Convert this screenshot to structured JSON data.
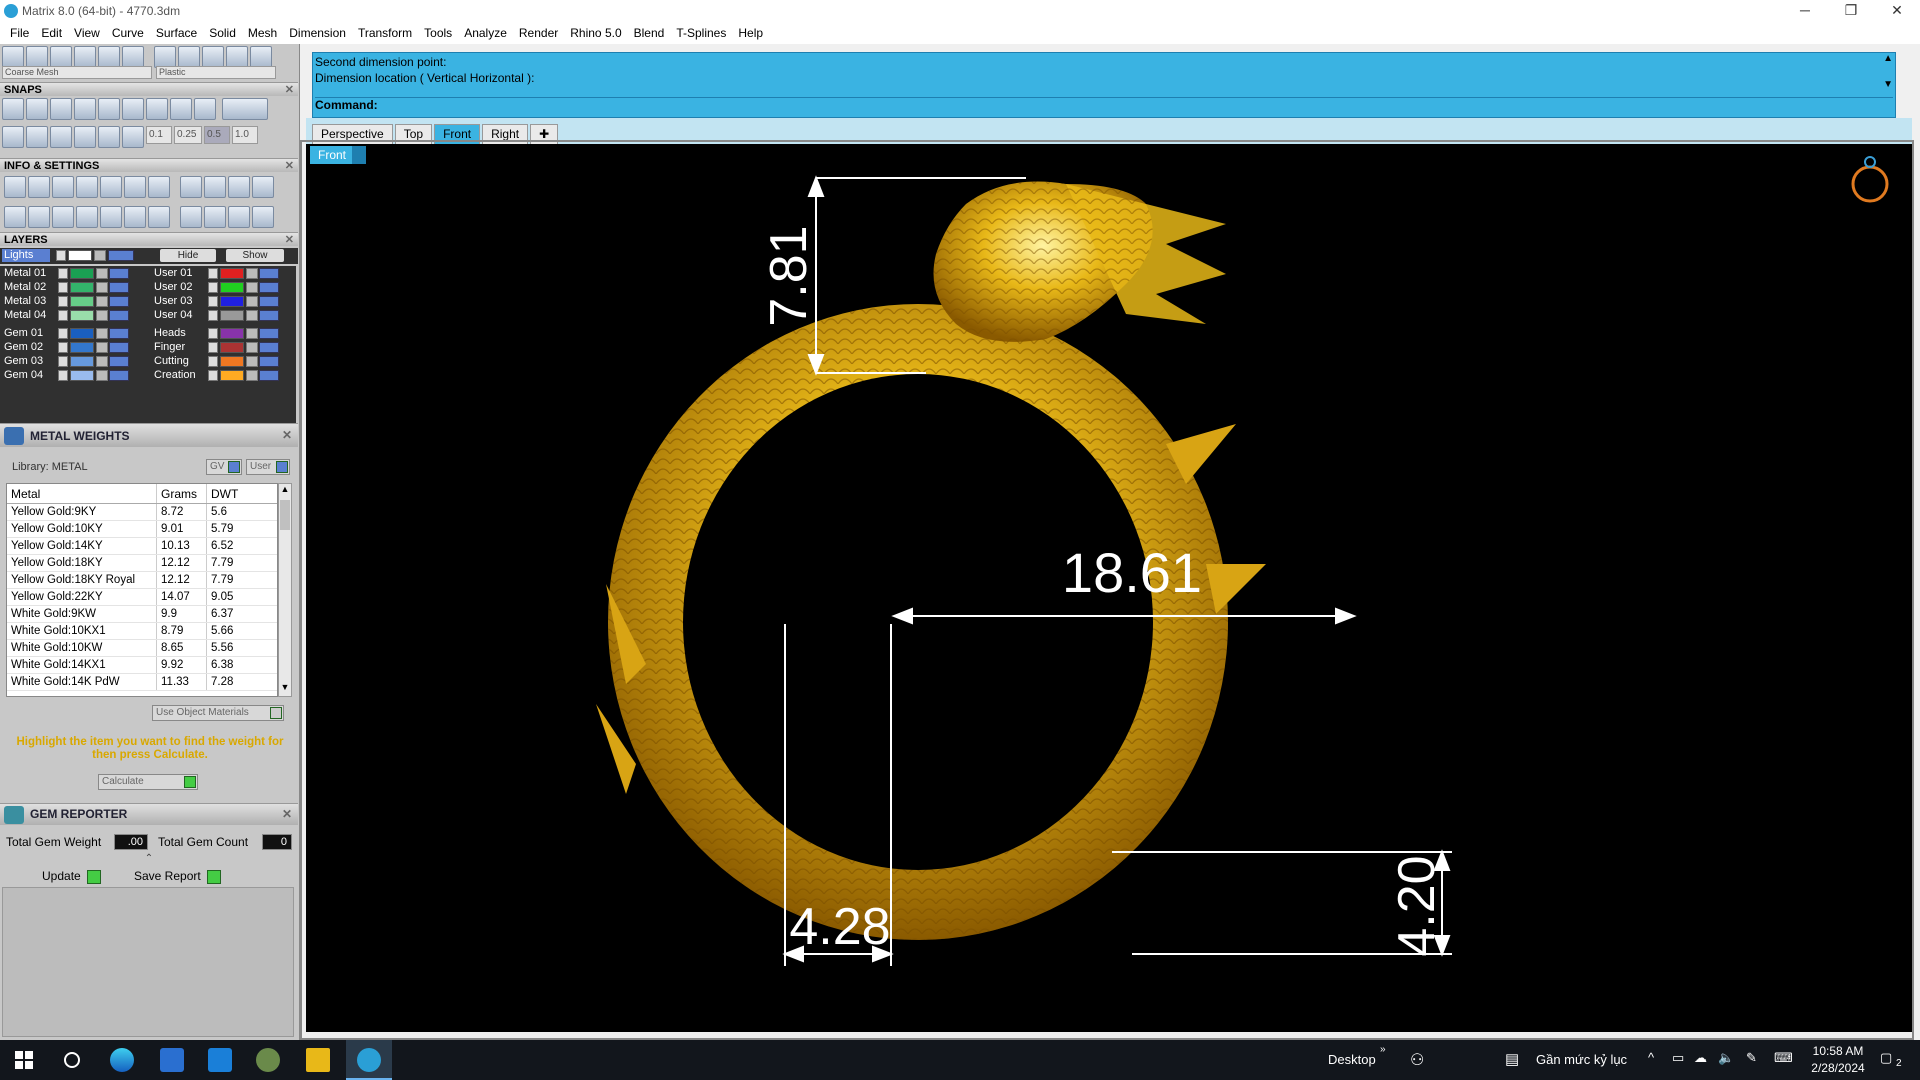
{
  "window": {
    "title": "Matrix 8.0 (64-bit) - 4770.3dm"
  },
  "menu": [
    "File",
    "Edit",
    "View",
    "Curve",
    "Surface",
    "Solid",
    "Mesh",
    "Dimension",
    "Transform",
    "Tools",
    "Analyze",
    "Render",
    "Rhino 5.0",
    "Blend",
    "T-Splines",
    "Help"
  ],
  "toolbar": {
    "mesh_dropdown": "Coarse Mesh",
    "material_dropdown": "Plastic"
  },
  "snaps": {
    "title": "SNAPS",
    "values": [
      "0.1",
      "0.25",
      "0.5",
      "1.0"
    ]
  },
  "info": {
    "title": "INFO & SETTINGS"
  },
  "layers": {
    "title": "LAYERS",
    "lights_label": "Lights",
    "hide_label": "Hide",
    "show_label": "Show",
    "left": [
      {
        "name": "Metal 01",
        "color": "#1aa053"
      },
      {
        "name": "Metal 02",
        "color": "#33b36b"
      },
      {
        "name": "Metal 03",
        "color": "#66cc88"
      },
      {
        "name": "Metal 04",
        "color": "#99ddaa"
      },
      {
        "name": "Gem 01",
        "color": "#1a5fbf"
      },
      {
        "name": "Gem 02",
        "color": "#3377cc"
      },
      {
        "name": "Gem 03",
        "color": "#6699dd"
      },
      {
        "name": "Gem 04",
        "color": "#99bbee"
      }
    ],
    "right": [
      {
        "name": "User 01",
        "color": "#e02020"
      },
      {
        "name": "User 02",
        "color": "#20d020"
      },
      {
        "name": "User 03",
        "color": "#2020e0"
      },
      {
        "name": "User 04",
        "color": "#999999"
      },
      {
        "name": "Heads",
        "color": "#8833aa"
      },
      {
        "name": "Finger",
        "color": "#aa3333"
      },
      {
        "name": "Cutting",
        "color": "#ee7722"
      },
      {
        "name": "Creation",
        "color": "#ffaa22"
      }
    ]
  },
  "metal_weights": {
    "title": "METAL WEIGHTS",
    "library": "Library: METAL",
    "gv": "GV",
    "user": "User",
    "columns": [
      "Metal",
      "Grams",
      "DWT"
    ],
    "rows": [
      [
        "Yellow Gold:9KY",
        "8.72",
        "5.6"
      ],
      [
        "Yellow Gold:10KY",
        "9.01",
        "5.79"
      ],
      [
        "Yellow Gold:14KY",
        "10.13",
        "6.52"
      ],
      [
        "Yellow Gold:18KY",
        "12.12",
        "7.79"
      ],
      [
        "Yellow Gold:18KY Royal",
        "12.12",
        "7.79"
      ],
      [
        "Yellow Gold:22KY",
        "14.07",
        "9.05"
      ],
      [
        "White Gold:9KW",
        "9.9",
        "6.37"
      ],
      [
        "White Gold:10KX1",
        "8.79",
        "5.66"
      ],
      [
        "White Gold:10KW",
        "8.65",
        "5.56"
      ],
      [
        "White Gold:14KX1",
        "9.92",
        "6.38"
      ],
      [
        "White Gold:14K PdW",
        "11.33",
        "7.28"
      ]
    ],
    "use_object_materials": "Use Object Materials",
    "hint": "Highlight the item you want to find the weight for then press Calculate.",
    "calculate": "Calculate"
  },
  "gem_reporter": {
    "title": "GEM REPORTER",
    "total_weight_label": "Total Gem Weight",
    "total_weight_value": ".00",
    "total_count_label": "Total Gem Count",
    "total_count_value": "0",
    "update": "Update",
    "save_report": "Save Report"
  },
  "command": {
    "line1": "Second dimension point:",
    "line2": "Dimension location ( Vertical  Horizontal ):",
    "prompt": "Command:"
  },
  "viewport": {
    "tabs": [
      "Perspective",
      "Top",
      "Front",
      "Right"
    ],
    "active_tab": "Front",
    "label": "Front",
    "dimensions": {
      "height": "7.81",
      "inner": "18.61",
      "left_width": "4.28",
      "right_height": "4.20"
    }
  },
  "taskbar": {
    "desktop": "Desktop",
    "language": "Gần mức kỷ lục",
    "time": "10:58 AM",
    "date": "2/28/2024",
    "notifications": "2"
  }
}
